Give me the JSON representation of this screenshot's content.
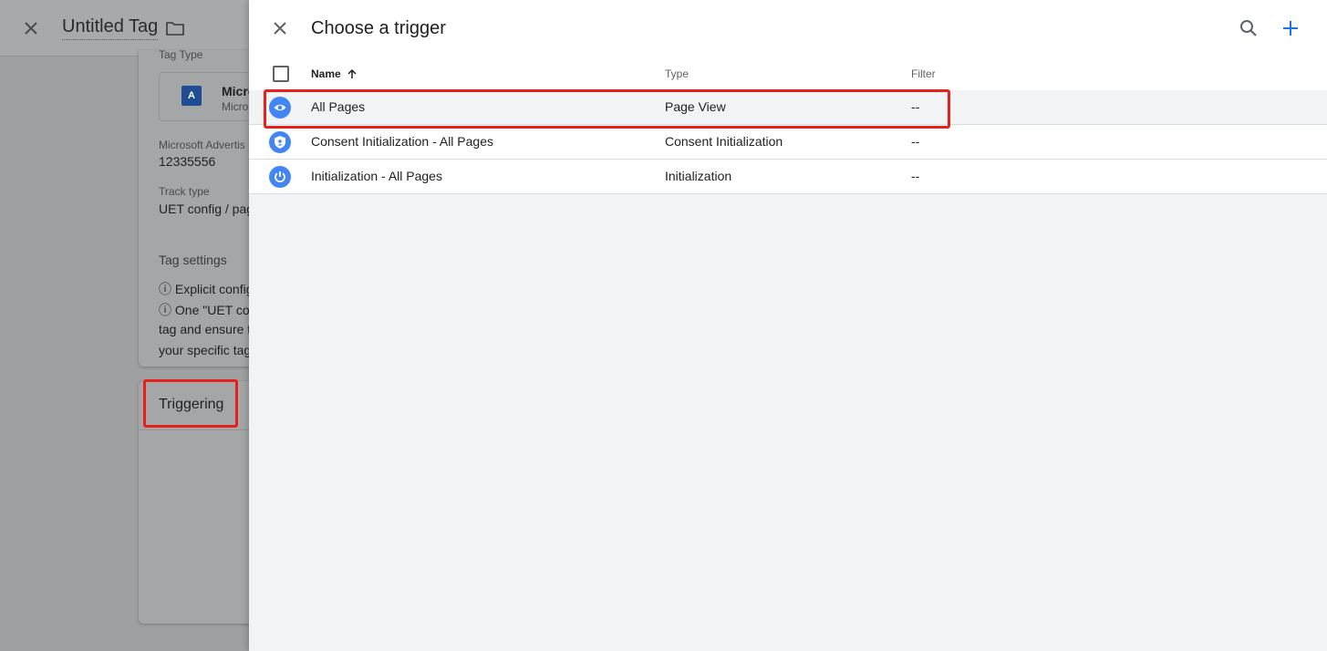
{
  "background": {
    "title": "Untitled Tag",
    "tag_type_label": "Tag Type",
    "tag_type_name": "Micro",
    "tag_type_sub": "Micro",
    "field1_label": "Microsoft Advertis",
    "field1_value": "12335556",
    "field2_label": "Track type",
    "field2_value": "UET config / pag",
    "settings_label": "Tag settings",
    "notes": [
      "ⓘ Explicit config",
      "ⓘ One \"UET conf",
      "tag and ensure t",
      "your specific tag"
    ],
    "triggering_label": "Triggering"
  },
  "panel": {
    "title": "Choose a trigger",
    "columns": {
      "name": "Name",
      "type": "Type",
      "filter": "Filter"
    },
    "rows": [
      {
        "name": "All Pages",
        "type": "Page View",
        "filter": "--",
        "icon": "eye-icon"
      },
      {
        "name": "Consent Initialization - All Pages",
        "type": "Consent Initialization",
        "filter": "--",
        "icon": "shield-icon"
      },
      {
        "name": "Initialization - All Pages",
        "type": "Initialization",
        "filter": "--",
        "icon": "power-icon"
      }
    ]
  },
  "colors": {
    "accent": "#1a73e8",
    "icon_bg": "#4285f4",
    "highlight": "#e8201c"
  }
}
